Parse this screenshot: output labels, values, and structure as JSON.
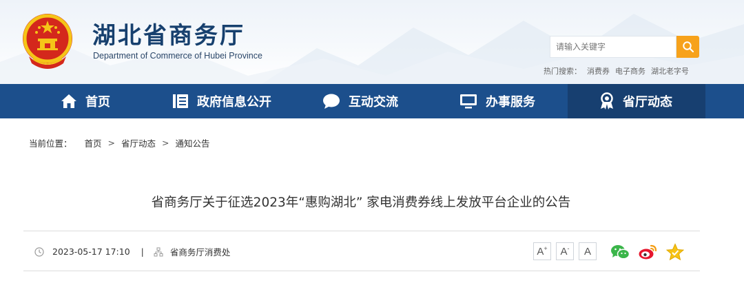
{
  "header": {
    "title": "湖北省商务厅",
    "subtitle": "Department of Commerce of Hubei Province"
  },
  "search": {
    "placeholder": "请输入关键字",
    "hot_label": "热门搜索：",
    "hot_terms": [
      "消费券",
      "电子商务",
      "湖北老字号"
    ]
  },
  "nav": {
    "items": [
      {
        "label": "首页",
        "icon": "home-icon"
      },
      {
        "label": "政府信息公开",
        "icon": "document-icon"
      },
      {
        "label": "互动交流",
        "icon": "chat-bubble-icon"
      },
      {
        "label": "办事服务",
        "icon": "monitor-icon"
      },
      {
        "label": "省厅动态",
        "icon": "award-icon",
        "active": true
      }
    ]
  },
  "breadcrumb": {
    "label": "当前位置：",
    "items": [
      "首页",
      "省厅动态",
      "通知公告"
    ],
    "separator": ">"
  },
  "article": {
    "title": "省商务厅关于征选2023年“惠购湖北” 家电消费券线上发放平台企业的公告",
    "datetime": "2023-05-17 17:10",
    "separator": "|",
    "source": "省商务厅消费处"
  },
  "font_size_buttons": [
    "A",
    "A",
    "A"
  ],
  "share_icons": [
    "wechat-icon",
    "weibo-icon",
    "favorite-star-icon"
  ],
  "colors": {
    "nav_bg": "#1c4f8c",
    "nav_active_bg": "#173f70",
    "title_blue": "#17406e",
    "search_button": "#f7a21b"
  }
}
